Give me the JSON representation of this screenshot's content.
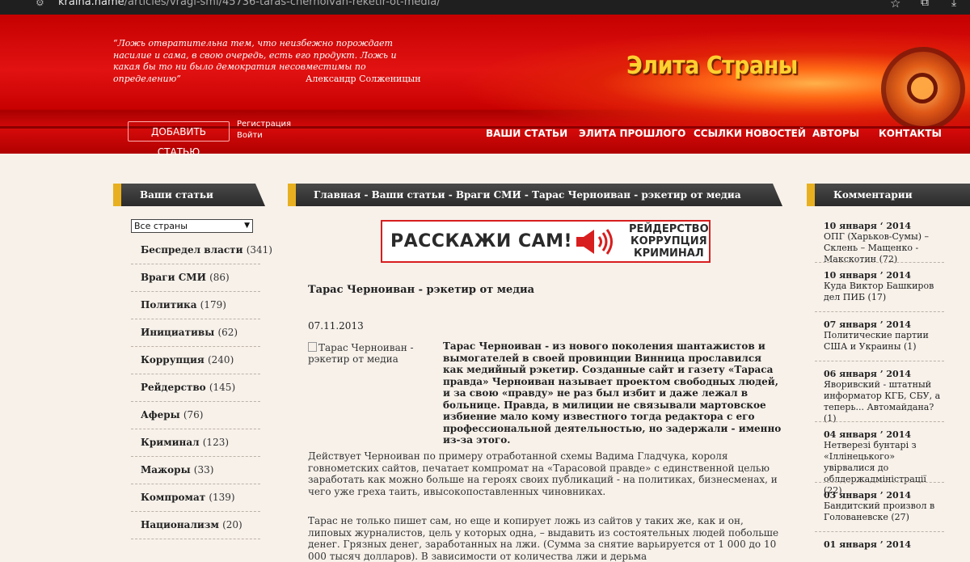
{
  "browser": {
    "url_host": "kraina.name",
    "url_path": "/articles/vragi-smi/45736-taras-chernoivan-reketir-ot-media/"
  },
  "header": {
    "quote": "“Ложь отвратительна тем, что неизбежно порождает насилие и сама, в свою очередь, есть его продукт. Ложь и какая бы то ни было демократия несовместимы по определению”",
    "quote_author": "Александр Солженицын",
    "logo": "Элита Страны",
    "add_article": "ДОБАВИТЬ СТАТЬЮ",
    "register": "Регистрация",
    "login": "Войти",
    "nav": [
      "ВАШИ СТАТЬИ",
      "ЭЛИТА ПРОШЛОГО",
      "ССЫЛКИ НОВОСТЕЙ",
      "АВТОРЫ",
      "КОНТАКТЫ"
    ]
  },
  "left": {
    "title": "Ваши статьи",
    "country_select": "Все страны",
    "categories": [
      {
        "name": "Беспредел власти",
        "count": "(341)"
      },
      {
        "name": "Враги СМИ",
        "count": "(86)"
      },
      {
        "name": "Политика",
        "count": "(179)"
      },
      {
        "name": "Инициативы",
        "count": "(62)"
      },
      {
        "name": "Коррупция",
        "count": "(240)"
      },
      {
        "name": "Рейдерство",
        "count": "(145)"
      },
      {
        "name": "Аферы",
        "count": "(76)"
      },
      {
        "name": "Криминал",
        "count": "(123)"
      },
      {
        "name": "Мажоры",
        "count": "(33)"
      },
      {
        "name": "Компромат",
        "count": "(139)"
      },
      {
        "name": "Национализм",
        "count": "(20)"
      }
    ]
  },
  "main": {
    "breadcrumb": "Главная - Ваши статьи - Враги СМИ - Тарас Черноиван - рэкетир от медиа",
    "banner_main": "РАССКАЖИ САМ!",
    "banner_tags": [
      "РЕЙДЕРСТВО",
      "КОРРУПЦИЯ",
      "КРИМИНАЛ"
    ],
    "article_title": "Тарас Черноиван - рэкетир от медиа",
    "article_date": "07.11.2013",
    "image_alt": "Тарас Черноиван - рэкетир от медиа",
    "lead": "Тарас Черноиван - из нового поколения шантажистов и вымогателей в своей провинции Винница прославился как медийный рэкетир. Созданные сайт и газету «Тараса правда» Черноиван называет проектом свободных людей, и за свою «правду» не раз был избит и даже лежал в больнице. Правда, в милиции не связывали мартовское избиение мало кому известного тогда редактора с его профессиональной деятельностью, но задержали - именно из-за этого.",
    "para1": "Действует Черноиван по примеру отработанной схемы Вадима Гладчука, короля говнометских сайтов, печатает компромат на «Тарасовой правде» с единственной целью заработать как можно больше на героях своих публикаций - на политиках, бизнесменах, и чего уже греха таить, ивысокопоставленных чиновниках.",
    "para2": "Тарас не только пишет сам, но еще и копирует ложь из сайтов у таких же, как и он, липовых журналистов, цель у которых одна, – выдавить из состоятельных людей побольше денег. Грязных денег, заработанных на лжи. (Сумма за снятие варьируется от 1 000 до 10 000 тысяч долларов). В зависимости от количества лжи и дерьма"
  },
  "right": {
    "title": "Комментарии",
    "comments": [
      {
        "date": "10 января ‘ 2014",
        "text": "ОПГ (Харьков-Сумы) – Склень – Мащенко - Макскотин (72)"
      },
      {
        "date": "10 января ’ 2014",
        "text": "Куда Виктор Башкиров дел ПИБ (17)"
      },
      {
        "date": "07 января ’ 2014",
        "text": "Политические партии США и Украины (1)"
      },
      {
        "date": "06 января ’ 2014",
        "text": "Яворивский - штатный информатор КГБ, СБУ, а теперь... Автомайдана? (1)"
      },
      {
        "date": "04 января ’ 2014",
        "text": "Нетверезі бунтарі з «Іллінецького» увірвалися до облдержадміністрації (22)"
      },
      {
        "date": "03 января ’ 2014",
        "text": "Бандитский произвол в Голованевске (27)"
      },
      {
        "date": "01 января ’ 2014",
        "text": ""
      }
    ]
  }
}
